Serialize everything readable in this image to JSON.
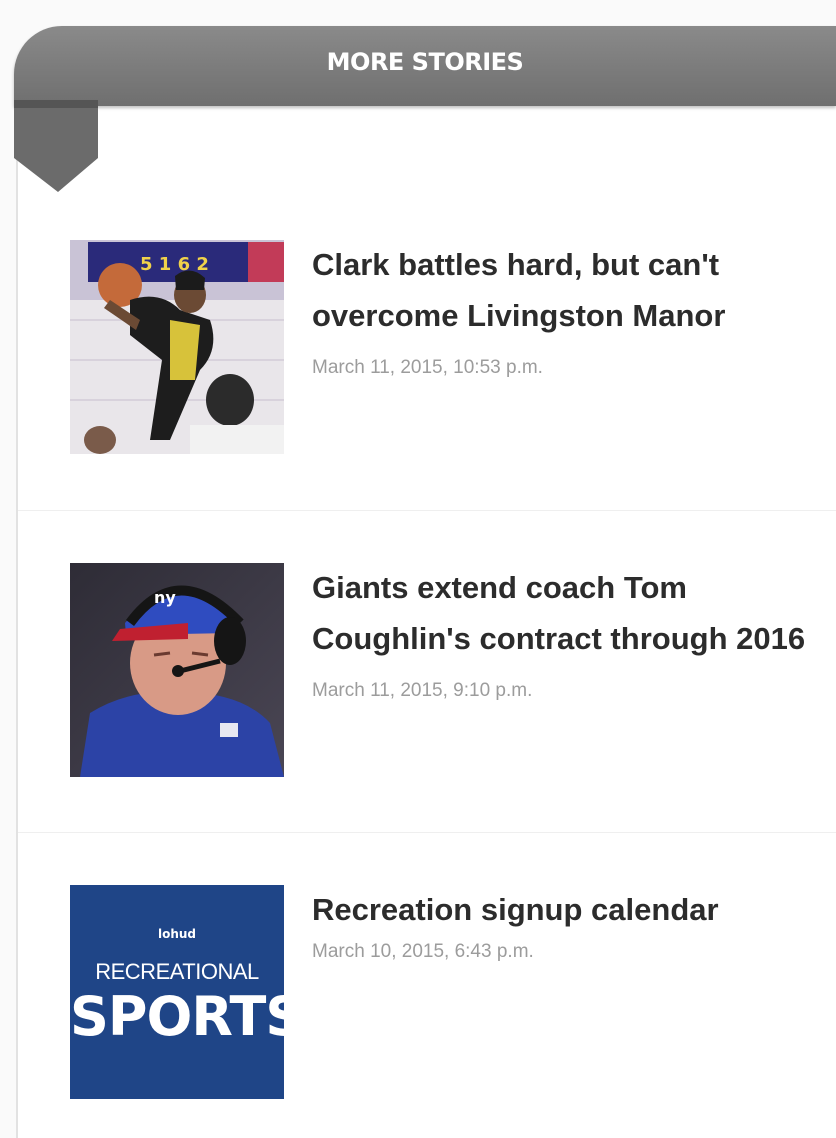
{
  "header": {
    "title": "MORE STORIES"
  },
  "stories": [
    {
      "headline": "Clark battles hard, but can't overcome Livingston Manor",
      "timestamp": "March 11, 2015, 10:53 p.m.",
      "thumb_icon": "basketball-player-photo"
    },
    {
      "headline": "Giants extend coach Tom Coughlin's contract through 2016",
      "timestamp": "March 11, 2015, 9:10 p.m.",
      "thumb_icon": "coach-headset-photo"
    },
    {
      "headline": "Recreation signup calendar",
      "timestamp": "March 10, 2015, 6:43 p.m.",
      "thumb_icon": "recreational-sports-logo",
      "thumb_text": {
        "brand": "lohud",
        "line1": "RECREATIONAL",
        "line2": "SPORTS"
      }
    }
  ],
  "colors": {
    "banner": "#7a7a7a",
    "headline": "#2c2c2c",
    "timestamp": "#9c9c9c",
    "rec_sports_bg": "#1f4587"
  }
}
